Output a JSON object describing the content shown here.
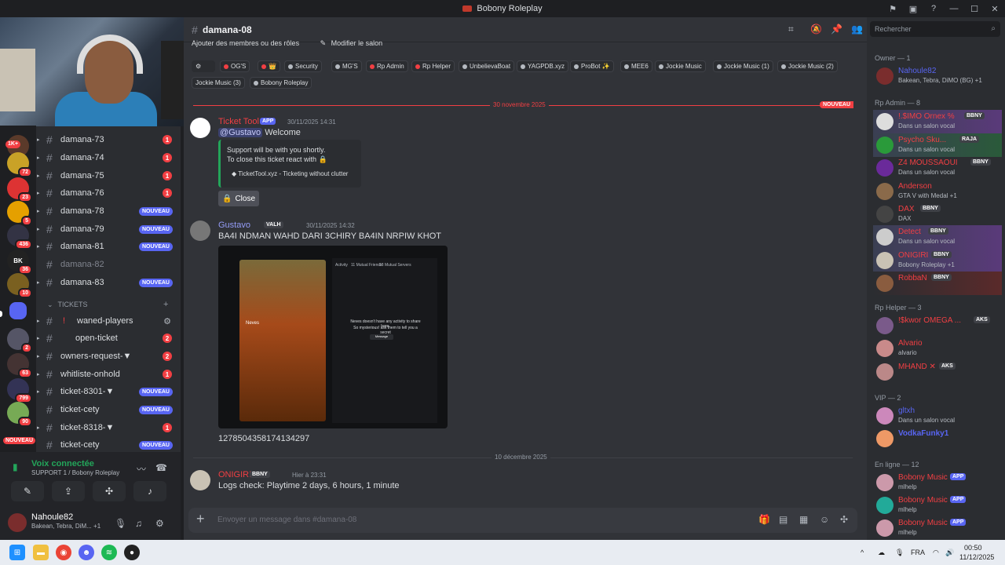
{
  "titlebar": {
    "title": "Bobony Roleplay"
  },
  "servers": [
    {
      "badge_left": "1K+"
    },
    {
      "badge": "72"
    },
    {
      "badge": "23"
    },
    {
      "badge": "5"
    },
    {
      "badge": "436"
    },
    {
      "badge": "36",
      "label": "BK"
    },
    {
      "badge": "10"
    },
    {
      "badge": ""
    },
    {
      "badge": "2"
    },
    {
      "badge": "63"
    },
    {
      "badge": "799"
    },
    {
      "badge": "90"
    }
  ],
  "servers_new": "NOUVEAU",
  "channels": [
    {
      "name": "damana-73",
      "count": "1"
    },
    {
      "name": "damana-74",
      "count": "1"
    },
    {
      "name": "damana-75",
      "count": "1"
    },
    {
      "name": "damana-76",
      "count": "1"
    },
    {
      "name": "damana-78",
      "new": "NOUVEAU"
    },
    {
      "name": "damana-79",
      "new": "NOUVEAU"
    },
    {
      "name": "damana-81",
      "new": "NOUVEAU"
    },
    {
      "name": "damana-82"
    },
    {
      "name": "damana-83",
      "new": "NOUVEAU"
    }
  ],
  "tickets_category": "TICKETS",
  "ticket_channels": [
    {
      "name": "waned-players",
      "prefix": "!"
    },
    {
      "name": "open-ticket",
      "count": "2"
    },
    {
      "name": "owners-request-▼",
      "count": "2"
    },
    {
      "name": "whitliste-onhold",
      "count": "1"
    },
    {
      "name": "ticket-8301-▼",
      "new": "NOUVEAU"
    },
    {
      "name": "ticket-cety",
      "new": "NOUVEAU"
    },
    {
      "name": "ticket-8318-▼",
      "count": "1"
    },
    {
      "name": "ticket-cety",
      "new": "NOUVEAU"
    }
  ],
  "voice": {
    "status": "Voix connectée",
    "channel": "SUPPORT 1 / Bobony Roleplay"
  },
  "user": {
    "name": "Nahoule82",
    "status": "Bakean, Tebra, DiM...",
    "extra": "+1"
  },
  "header": {
    "channel": "damana-08",
    "sub_left": "Ajouter des membres ou des rôles",
    "sub_right": "Modifier le salon"
  },
  "roles": [
    "OG'S",
    "",
    "Security",
    "MG'S",
    "Rp Admin",
    "Rp Helper",
    "UnbelievaBoat",
    "YAGPDB.xyz",
    "ProBot ✨",
    "MEE6",
    "Jockie Music",
    "Jockie Music (1)",
    "Jockie Music (2)",
    "Jockie Music (3)",
    "Bobony Roleplay"
  ],
  "separator_1": {
    "date": "30 novembre 2025",
    "new": "NOUVEAU"
  },
  "msg1": {
    "author": "Ticket Tool",
    "app": "APP",
    "time": "30/11/2025 14:31",
    "mention": "@Gustavo",
    "text": "Welcome",
    "embed_line1": "Support will be with you shortly.",
    "embed_line2": "To close this ticket react with 🔒",
    "embed_footer": "TicketTool.xyz - Ticketing without clutter",
    "close_label": "Close"
  },
  "msg2": {
    "author": "Gustavo",
    "tag": "VALH",
    "time": "30/11/2025 14:32",
    "text": "BA4I NDMAN WAHD DARI 3CHIRY BA4IN NRPIW KHOT",
    "attach": {
      "tab1": "Activity",
      "tab2": "11 Mutual Friends",
      "tab3": "18 Mutual Servers",
      "card_name": "Neves",
      "empty_text": "Neves doesn't have any activity to share here.",
      "empty_sub": "So mysterious! ask them to tell you a secret",
      "message_btn": "Message"
    },
    "id_text": "1278504358174134297"
  },
  "separator_2": {
    "date": "10 décembre 2025"
  },
  "msg3": {
    "author": "ONIGIRI",
    "tag": "BBNY",
    "time": "Hier à 23:31",
    "text": "Logs check: Playtime 2 days, 6 hours, 1 minute"
  },
  "composer": {
    "placeholder": "Envoyer un message dans #damana-08"
  },
  "search": {
    "placeholder": "Rechercher"
  },
  "member_groups": {
    "owner": "Owner — 1",
    "rpadmin": "Rp Admin — 8",
    "rphelper": "Rp Helper — 3",
    "vip": "VIP — 2",
    "online": "En ligne — 12"
  },
  "members": [
    {
      "name": "Nahoule82",
      "sub": "Bakean, Tebra, DiMO (BG) +1",
      "color": "#5865f2"
    },
    {
      "name": "!.$IMO Ornex %",
      "tag": "BBNY",
      "sub": "Dans un salon vocal",
      "color": "#f23f43"
    },
    {
      "name": "Psycho Sku...",
      "tag": "RAJA",
      "sub": "Dans un salon vocal",
      "color": "#f23f43"
    },
    {
      "name": "Z4 MOUSSAOUI",
      "tag": "BBNY",
      "sub": "Dans un salon vocal",
      "color": "#f23f43"
    },
    {
      "name": "Anderson",
      "sub": "GTA V with Medal +1",
      "color": "#f23f43"
    },
    {
      "name": "DAX",
      "tag": "BBNY",
      "sub": "DAX",
      "color": "#f23f43"
    },
    {
      "name": "Detect",
      "tag": "BBNY",
      "sub": "Dans un salon vocal",
      "color": "#f23f43"
    },
    {
      "name": "ONIGIRI",
      "tag": "BBNY",
      "sub": "Bobony Roleplay +1",
      "color": "#f23f43"
    },
    {
      "name": "RobbaN",
      "tag": "BBNY",
      "sub": "",
      "color": "#f23f43"
    },
    {
      "name": "!$kwor ΟΜΕGΑ ...",
      "tag": "AKS",
      "sub": "",
      "color": "#f23f43"
    },
    {
      "name": "Alvario",
      "sub": "alvario",
      "color": "#f23f43"
    },
    {
      "name": "MHAND ✕",
      "tag": "AKS",
      "sub": "",
      "color": "#f23f43"
    },
    {
      "name": "gltxh",
      "sub": "Dans un salon vocal",
      "color": "#5865f2"
    },
    {
      "name": "VodkaFunky1",
      "sub": "",
      "color": "#5865f2"
    },
    {
      "name": "Bobony Music",
      "app": "APP",
      "sub": "mlhelp",
      "color": "#f23f43"
    },
    {
      "name": "Bobony Music",
      "app": "APP",
      "sub": "mlhelp",
      "color": "#f23f43"
    },
    {
      "name": "Bobony Music",
      "app": "APP",
      "sub": "mlhelp",
      "color": "#f23f43"
    }
  ],
  "taskbar": {
    "lang": "FRA",
    "time": "00:50",
    "date": "11/12/2025"
  }
}
